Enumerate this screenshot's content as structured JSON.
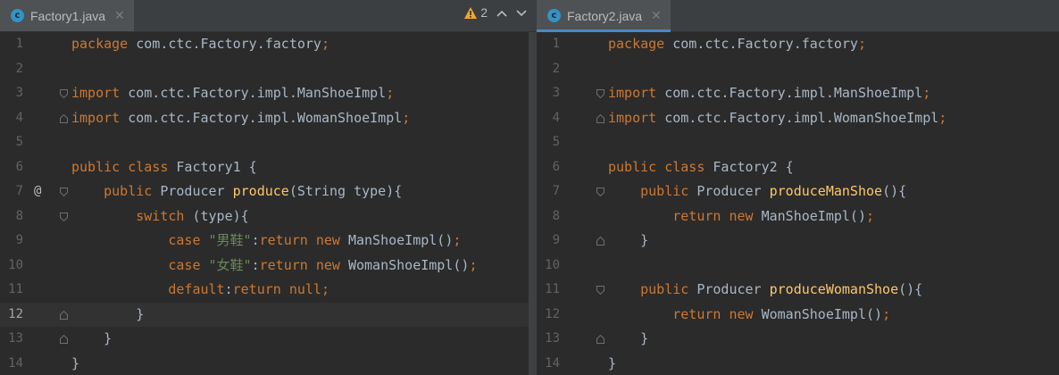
{
  "left": {
    "tab_label": "Factory1.java",
    "inspection": {
      "count": "2"
    },
    "lines": [
      {
        "n": "1",
        "tokens": [
          {
            "t": "package ",
            "c": "kw"
          },
          {
            "t": "com.ctc.Factory.factory"
          },
          {
            "t": ";",
            "c": "kw"
          }
        ]
      },
      {
        "n": "2",
        "tokens": []
      },
      {
        "n": "3",
        "fold": "open",
        "tokens": [
          {
            "t": "import ",
            "c": "kw"
          },
          {
            "t": "com.ctc.Factory.impl.ManShoeImpl"
          },
          {
            "t": ";",
            "c": "kw"
          }
        ]
      },
      {
        "n": "4",
        "fold": "close",
        "tokens": [
          {
            "t": "import ",
            "c": "kw"
          },
          {
            "t": "com.ctc.Factory.impl.WomanShoeImpl"
          },
          {
            "t": ";",
            "c": "kw"
          }
        ]
      },
      {
        "n": "5",
        "tokens": []
      },
      {
        "n": "6",
        "tokens": [
          {
            "t": "public class ",
            "c": "kw"
          },
          {
            "t": "Factory1 {"
          }
        ]
      },
      {
        "n": "7",
        "mark": "@",
        "fold": "open",
        "tokens": [
          {
            "t": "    "
          },
          {
            "t": "public ",
            "c": "kw"
          },
          {
            "t": "Producer "
          },
          {
            "t": "produce",
            "c": "fn"
          },
          {
            "t": "(String type){"
          }
        ]
      },
      {
        "n": "8",
        "fold": "open",
        "tokens": [
          {
            "t": "        "
          },
          {
            "t": "switch ",
            "c": "kw"
          },
          {
            "t": "(type){"
          }
        ]
      },
      {
        "n": "9",
        "tokens": [
          {
            "t": "            "
          },
          {
            "t": "case ",
            "c": "kw"
          },
          {
            "t": "\"男鞋\"",
            "c": "str"
          },
          {
            "t": ":"
          },
          {
            "t": "return new ",
            "c": "kw"
          },
          {
            "t": "ManShoeImpl()"
          },
          {
            "t": ";",
            "c": "kw"
          }
        ]
      },
      {
        "n": "10",
        "tokens": [
          {
            "t": "            "
          },
          {
            "t": "case ",
            "c": "kw"
          },
          {
            "t": "\"女鞋\"",
            "c": "str"
          },
          {
            "t": ":"
          },
          {
            "t": "return new ",
            "c": "kw"
          },
          {
            "t": "WomanShoeImpl()"
          },
          {
            "t": ";",
            "c": "kw"
          }
        ]
      },
      {
        "n": "11",
        "tokens": [
          {
            "t": "            "
          },
          {
            "t": "default",
            "c": "kw"
          },
          {
            "t": ":"
          },
          {
            "t": "return null;",
            "c": "kw"
          }
        ]
      },
      {
        "n": "12",
        "current": true,
        "fold": "close",
        "tokens": [
          {
            "t": "        }"
          }
        ]
      },
      {
        "n": "13",
        "fold": "close",
        "tokens": [
          {
            "t": "    }"
          }
        ]
      },
      {
        "n": "14",
        "tokens": [
          {
            "t": "}"
          }
        ]
      }
    ]
  },
  "right": {
    "tab_label": "Factory2.java",
    "lines": [
      {
        "n": "1",
        "tokens": [
          {
            "t": "package ",
            "c": "kw"
          },
          {
            "t": "com.ctc.Factory.factory"
          },
          {
            "t": ";",
            "c": "kw"
          }
        ]
      },
      {
        "n": "2",
        "tokens": []
      },
      {
        "n": "3",
        "fold": "open",
        "tokens": [
          {
            "t": "import ",
            "c": "kw"
          },
          {
            "t": "com.ctc.Factory.impl.ManShoeImpl"
          },
          {
            "t": ";",
            "c": "kw"
          }
        ]
      },
      {
        "n": "4",
        "fold": "close",
        "tokens": [
          {
            "t": "import ",
            "c": "kw"
          },
          {
            "t": "com.ctc.Factory.impl.WomanShoeImpl"
          },
          {
            "t": ";",
            "c": "kw"
          }
        ]
      },
      {
        "n": "5",
        "tokens": []
      },
      {
        "n": "6",
        "tokens": [
          {
            "t": "public class ",
            "c": "kw"
          },
          {
            "t": "Factory2 {"
          }
        ]
      },
      {
        "n": "7",
        "fold": "open",
        "tokens": [
          {
            "t": "    "
          },
          {
            "t": "public ",
            "c": "kw"
          },
          {
            "t": "Producer "
          },
          {
            "t": "produceManShoe",
            "c": "fn"
          },
          {
            "t": "(){"
          }
        ]
      },
      {
        "n": "8",
        "tokens": [
          {
            "t": "        "
          },
          {
            "t": "return new ",
            "c": "kw"
          },
          {
            "t": "ManShoeImpl()"
          },
          {
            "t": ";",
            "c": "kw"
          }
        ]
      },
      {
        "n": "9",
        "fold": "close",
        "tokens": [
          {
            "t": "    }"
          }
        ]
      },
      {
        "n": "10",
        "tokens": []
      },
      {
        "n": "11",
        "fold": "open",
        "tokens": [
          {
            "t": "    "
          },
          {
            "t": "public ",
            "c": "kw"
          },
          {
            "t": "Producer "
          },
          {
            "t": "produceWomanShoe",
            "c": "fn"
          },
          {
            "t": "(){"
          }
        ]
      },
      {
        "n": "12",
        "tokens": [
          {
            "t": "        "
          },
          {
            "t": "return new ",
            "c": "kw"
          },
          {
            "t": "WomanShoeImpl()"
          },
          {
            "t": ";",
            "c": "kw"
          }
        ]
      },
      {
        "n": "13",
        "fold": "close",
        "tokens": [
          {
            "t": "    }"
          }
        ]
      },
      {
        "n": "14",
        "tokens": [
          {
            "t": "}"
          }
        ]
      }
    ]
  },
  "colors": {
    "keyword": "#cc7832",
    "method": "#ffc66d",
    "string": "#6a8759",
    "text": "#a9b7c6",
    "background": "#2b2b2b",
    "tab_accent": "#4a88c7"
  },
  "icons": {
    "tab_file": "java-class-icon",
    "tab_close": "close-icon",
    "warning": "warning-icon",
    "prev": "chevron-up-icon",
    "next": "chevron-down-icon"
  }
}
